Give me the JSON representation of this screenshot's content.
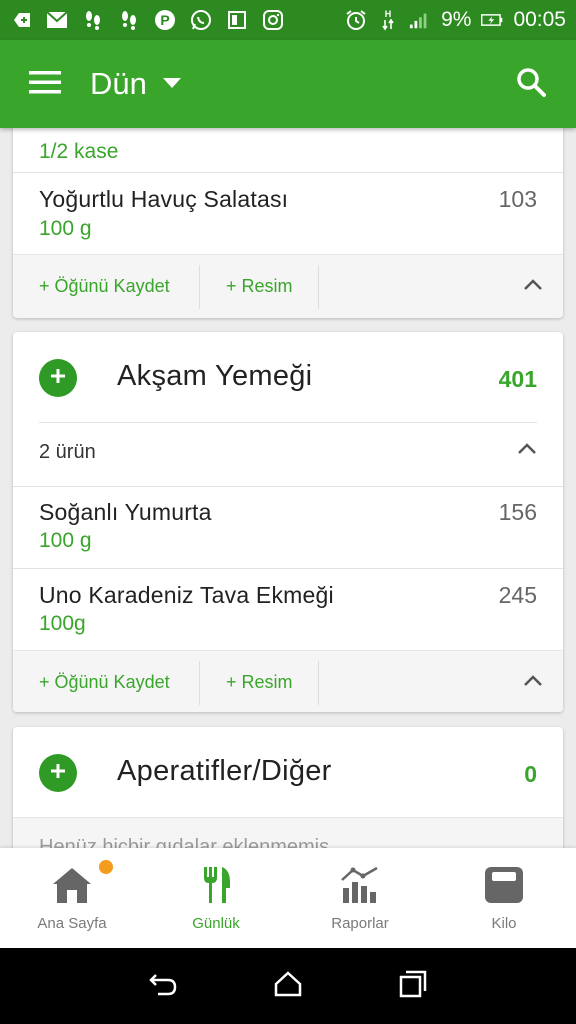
{
  "status_bar": {
    "battery": "9%",
    "time": "00:05"
  },
  "app_bar": {
    "title": "Dün"
  },
  "breakfast_card": {
    "partial_row_qty": "1/2 kase",
    "items": [
      {
        "name": "Yoğurtlu Havuç Salatası",
        "qty": "100  g",
        "cal": "103"
      }
    ],
    "actions": {
      "save": "+ Öğünü Kaydet",
      "photo": "+ Resim"
    }
  },
  "dinner_card": {
    "title": "Akşam Yemeği",
    "calories": "401",
    "item_count": "2 ürün",
    "items": [
      {
        "name": "Soğanlı Yumurta",
        "qty": "100  g",
        "cal": "156"
      },
      {
        "name": "Uno Karadeniz Tava Ekmeği",
        "qty": "100g",
        "cal": "245"
      }
    ],
    "actions": {
      "save": "+ Öğünü Kaydet",
      "photo": "+ Resim"
    }
  },
  "snacks_card": {
    "title": "Aperatifler/Diğer",
    "calories": "0",
    "empty_text": "Henüz hiçbir gıdalar eklenmemiş"
  },
  "bottom_nav": {
    "items": [
      {
        "label": "Ana Sayfa",
        "icon": "home-icon"
      },
      {
        "label": "Günlük",
        "icon": "fork-knife-icon"
      },
      {
        "label": "Raporlar",
        "icon": "chart-icon"
      },
      {
        "label": "Kilo",
        "icon": "scale-icon"
      }
    ],
    "active": "Günlük"
  },
  "colors": {
    "status_bar": "#2c8a21",
    "app_bar": "#3aa52b",
    "accent_green": "#3aa52b",
    "notification_dot": "#f39c1e"
  }
}
